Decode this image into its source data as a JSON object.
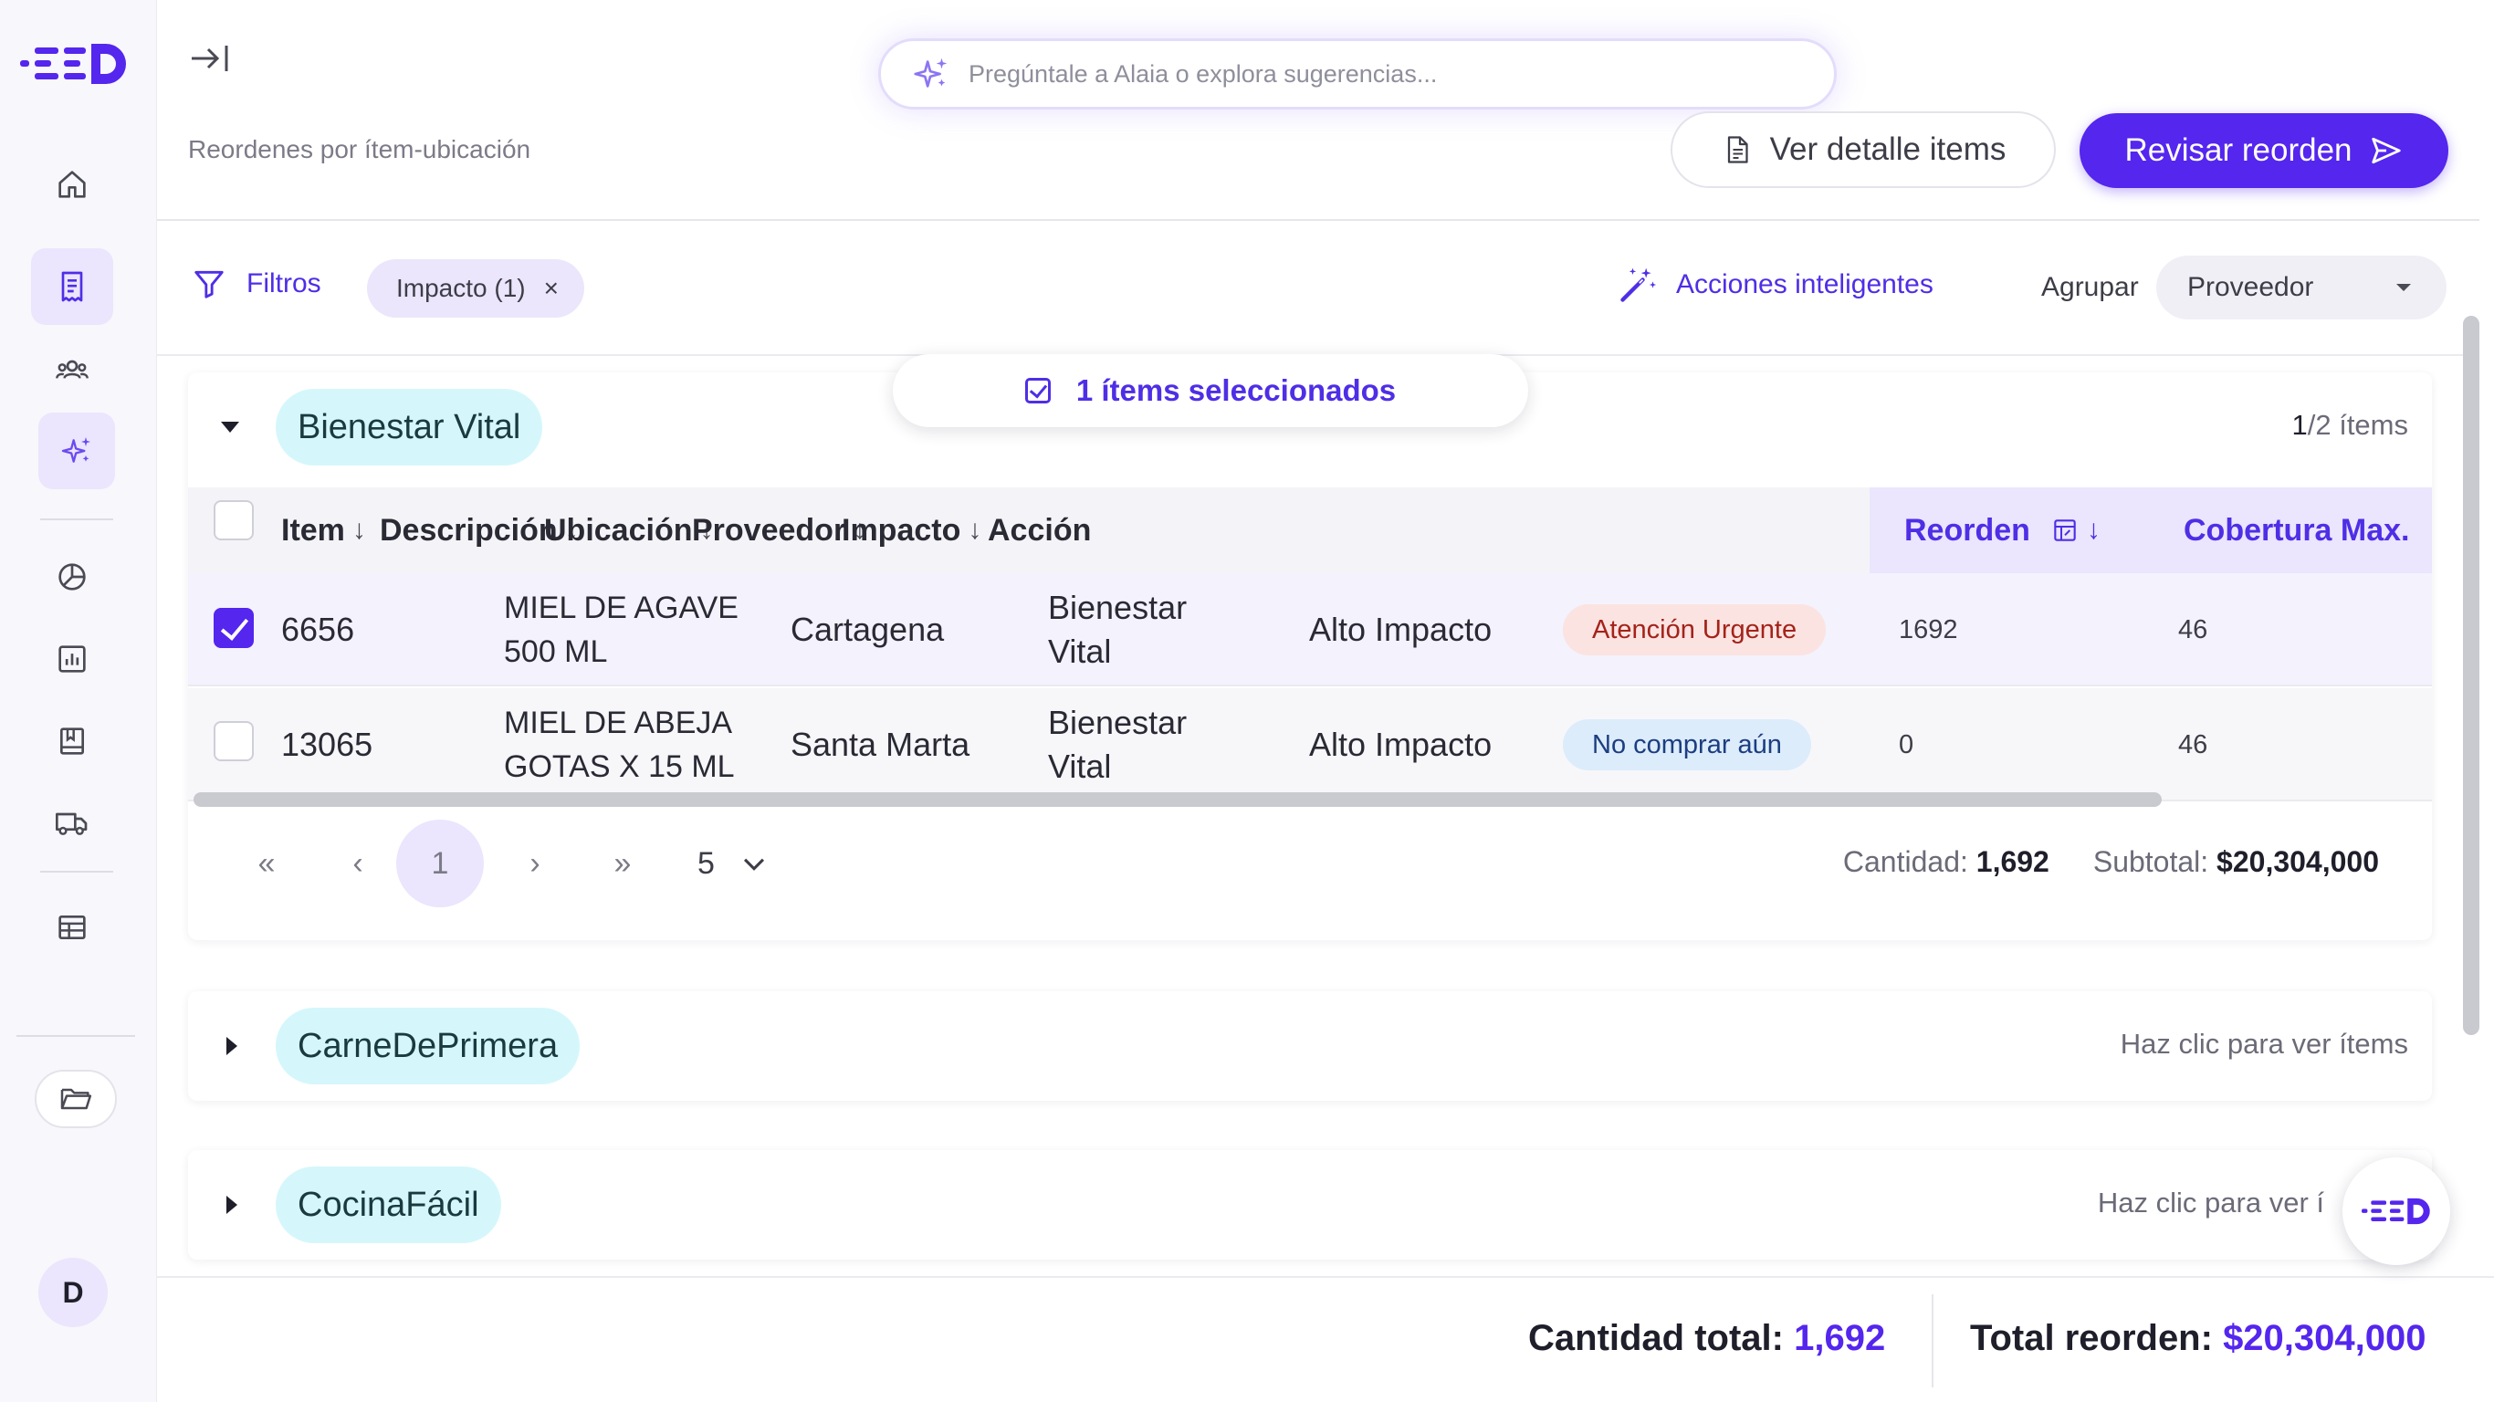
{
  "header": {
    "ai_search_placeholder": "Pregúntale a Alaia o explora sugerencias...",
    "subtitle": "Reordenes por ítem-ubicación",
    "view_items_label": "Ver detalle items",
    "review_label": "Revisar reorden"
  },
  "toolbar": {
    "filters_label": "Filtros",
    "filter_chip": "Impacto (1)",
    "chip_close": "×",
    "smart_actions_label": "Acciones inteligentes",
    "group_label": "Agrupar",
    "group_value": "Proveedor"
  },
  "selection": {
    "label": "1 ítems seleccionados"
  },
  "groups": [
    {
      "name": "Bienestar Vital",
      "count_current": "1",
      "count_rest": "/2 ítems"
    },
    {
      "name": "CarneDePrimera",
      "hint": "Haz clic para ver ítems"
    },
    {
      "name": "CocinaFácil",
      "hint": "Haz clic para ver í"
    }
  ],
  "table": {
    "columns": [
      "Item",
      "Descripción",
      "Ubicación",
      "Proveedor",
      "Impacto",
      "Acción",
      "Reorden",
      "Cobertura Max."
    ],
    "rows": [
      {
        "item": "6656",
        "desc1": "MIEL DE AGAVE",
        "desc2": "500 ML",
        "location": "Cartagena",
        "sup1": "Bienestar",
        "sup2": "Vital",
        "impact": "Alto Impacto",
        "action": "Atención Urgente",
        "reorder": "1692",
        "coverage": "46",
        "selected": true
      },
      {
        "item": "13065",
        "desc1": "MIEL DE ABEJA",
        "desc2": "GOTAS X 15 ML",
        "location": "Santa Marta",
        "sup1": "Bienestar",
        "sup2": "Vital",
        "impact": "Alto Impacto",
        "action": "No comprar aún",
        "reorder": "0",
        "coverage": "46",
        "selected": false
      }
    ]
  },
  "pagination": {
    "first": "«",
    "prev": "‹",
    "current": "1",
    "next": "›",
    "last": "»",
    "page_size": "5"
  },
  "group_totals": {
    "qty_label": "Cantidad:",
    "qty_value": "1,692",
    "subtotal_label": "Subtotal:",
    "subtotal_value": "$20,304,000"
  },
  "footer": {
    "total_qty_label": "Cantidad total:",
    "total_qty_value": "1,692",
    "total_label": "Total reorden:",
    "total_value": "$20,304,000"
  },
  "user": {
    "initial": "D"
  },
  "colors": {
    "accent": "#5426ee",
    "accent_light": "#ebe5fd",
    "supplier_pill": "#d5f7fb"
  }
}
